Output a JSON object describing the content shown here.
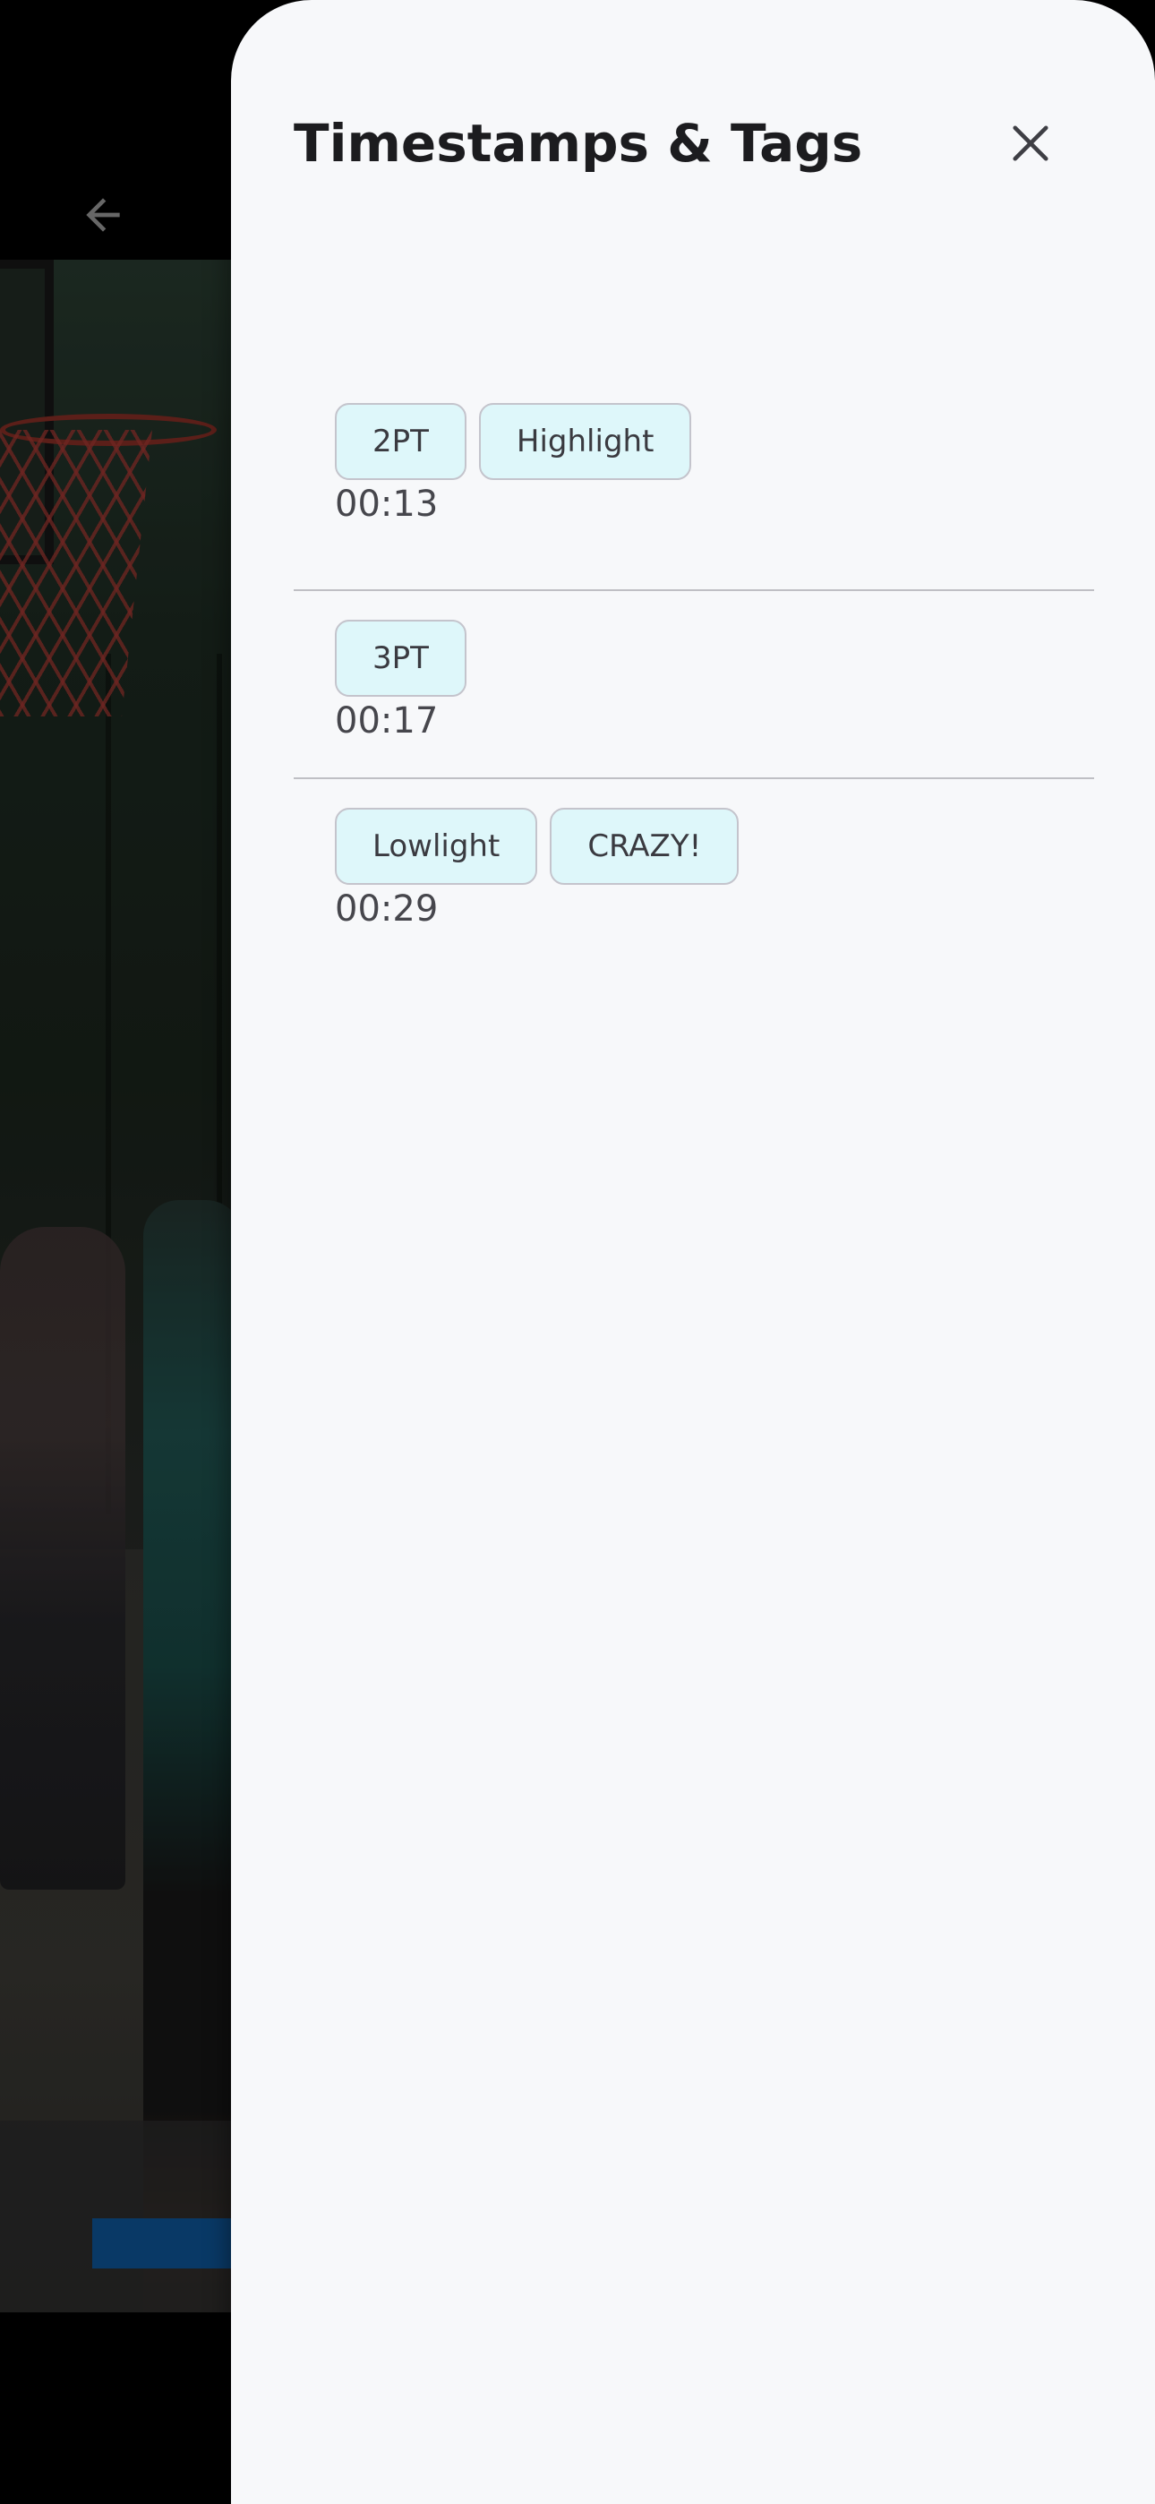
{
  "drawer": {
    "title": "Timestamps & Tags",
    "entries": [
      {
        "tags": [
          "2PT",
          "Highlight"
        ],
        "time": "00:13"
      },
      {
        "tags": [
          "3PT"
        ],
        "time": "00:17"
      },
      {
        "tags": [
          "Lowlight",
          "CRAZY!"
        ],
        "time": "00:29"
      }
    ]
  },
  "player": {
    "progress": 0.155
  },
  "icons": {
    "back": "arrow-left-icon",
    "close": "close-icon"
  },
  "colors": {
    "drawer_background": "#f7f8fa",
    "chip_background": "#def7fa",
    "progress_fill": "#0d4d88"
  }
}
